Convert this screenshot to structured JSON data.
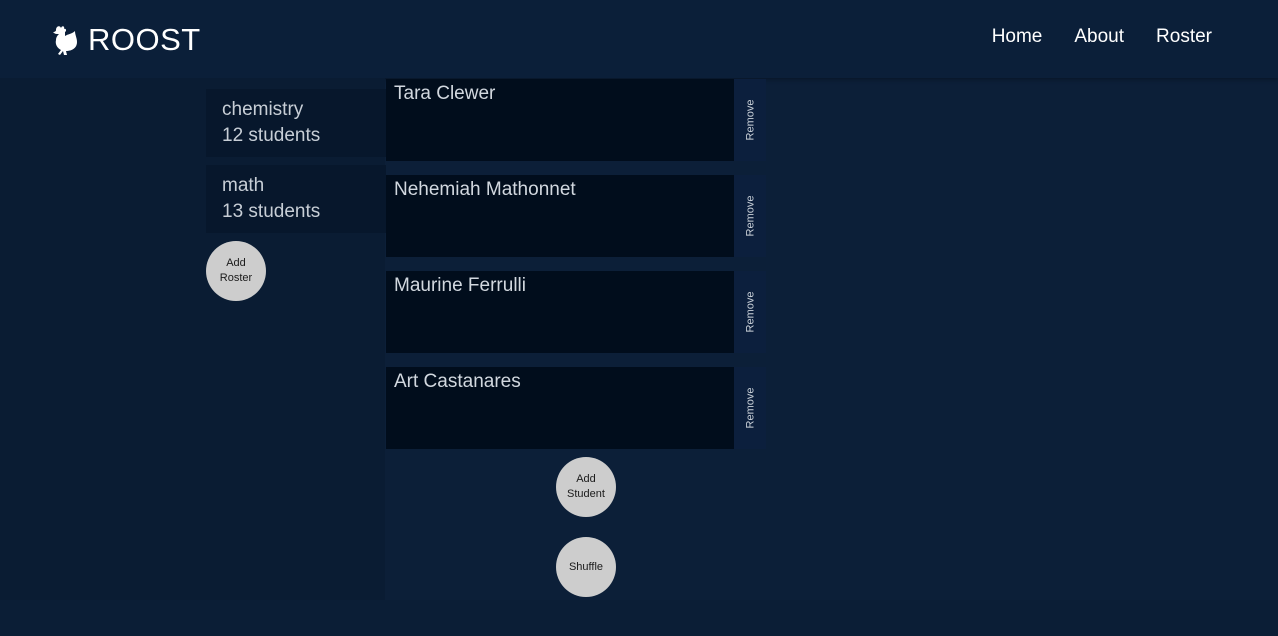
{
  "header": {
    "brand": "ROOST",
    "logo_icon": "rooster-icon",
    "nav": [
      "Home",
      "About",
      "Roster"
    ]
  },
  "rosters": [
    {
      "name": "chemistry",
      "count": "12 students"
    },
    {
      "name": "math",
      "count": "13 students"
    }
  ],
  "add_roster": {
    "line1": "Add",
    "line2": "Roster"
  },
  "students": [
    {
      "name": "Tara Clewer",
      "remove": "Remove"
    },
    {
      "name": "Nehemiah Mathonnet",
      "remove": "Remove"
    },
    {
      "name": "Maurine Ferrulli",
      "remove": "Remove"
    },
    {
      "name": "Art Castanares",
      "remove": "Remove"
    }
  ],
  "add_student": {
    "line1": "Add",
    "line2": "Student"
  },
  "shuffle": "Shuffle",
  "colors": {
    "background": "#0c1f38",
    "card": "#010d1c",
    "button": "#cdcdcd"
  }
}
